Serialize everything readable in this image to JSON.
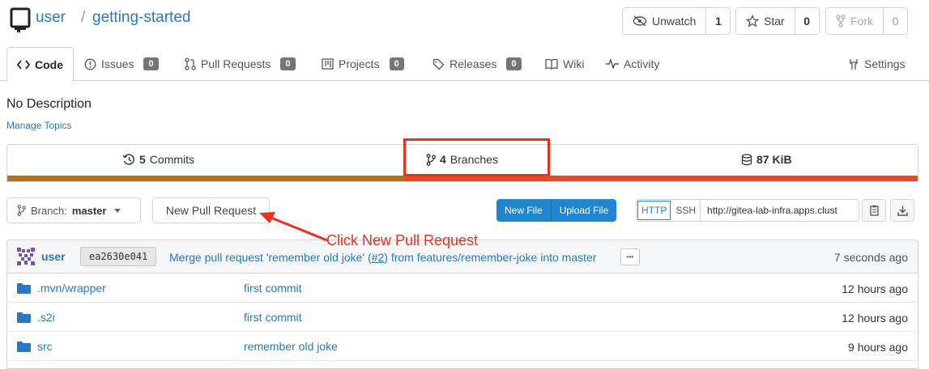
{
  "header": {
    "owner": "user",
    "separator": "/",
    "repo": "getting-started",
    "watch": {
      "label": "Unwatch",
      "count": "1"
    },
    "star": {
      "label": "Star",
      "count": "0"
    },
    "fork": {
      "label": "Fork",
      "count": "0"
    }
  },
  "tabs": [
    {
      "label": "Code",
      "icon": "code-icon"
    },
    {
      "label": "Issues",
      "badge": "0",
      "icon": "issue-icon"
    },
    {
      "label": "Pull Requests",
      "badge": "0",
      "icon": "pull-request-icon"
    },
    {
      "label": "Projects",
      "badge": "0",
      "icon": "project-icon"
    },
    {
      "label": "Releases",
      "badge": "0",
      "icon": "tag-icon"
    },
    {
      "label": "Wiki",
      "icon": "book-icon"
    },
    {
      "label": "Activity",
      "icon": "pulse-icon"
    },
    {
      "label": "Settings",
      "icon": "tools-icon"
    }
  ],
  "description": "No Description",
  "manage_topics": "Manage Topics",
  "stats": {
    "commits_count": "5",
    "commits_label": "Commits",
    "branches_count": "4",
    "branches_label": "Branches",
    "size": "87 KiB"
  },
  "colors": {
    "accent": "#2185d0",
    "lang_primary": "#b07219",
    "lang_secondary": "#e34c26",
    "annotation": "#e8321c"
  },
  "actions": {
    "branch_prefix": "Branch:",
    "branch_name": "master",
    "new_pull_request": "New Pull Request",
    "new_file": "New File",
    "upload_file": "Upload File",
    "http": "HTTP",
    "ssh": "SSH",
    "clone_url": "http://gitea-lab-infra.apps.clust"
  },
  "annotation": "Click New Pull Request",
  "latest_commit": {
    "author": "user",
    "sha": "ea2630e041",
    "message_start": "Merge pull request 'remember old joke' (",
    "pr_link": "#2",
    "message_end": ") from features/remember-joke into master",
    "more": "•••",
    "time": "7 seconds ago"
  },
  "files": [
    {
      "dir": ".mvn/",
      "name": "wrapper",
      "message": "first commit",
      "time": "12 hours ago"
    },
    {
      "dir": "",
      "name": ".s2i",
      "message": "first commit",
      "time": "12 hours ago"
    },
    {
      "dir": "",
      "name": "src",
      "message": "remember old joke",
      "time": "9 hours ago"
    }
  ]
}
